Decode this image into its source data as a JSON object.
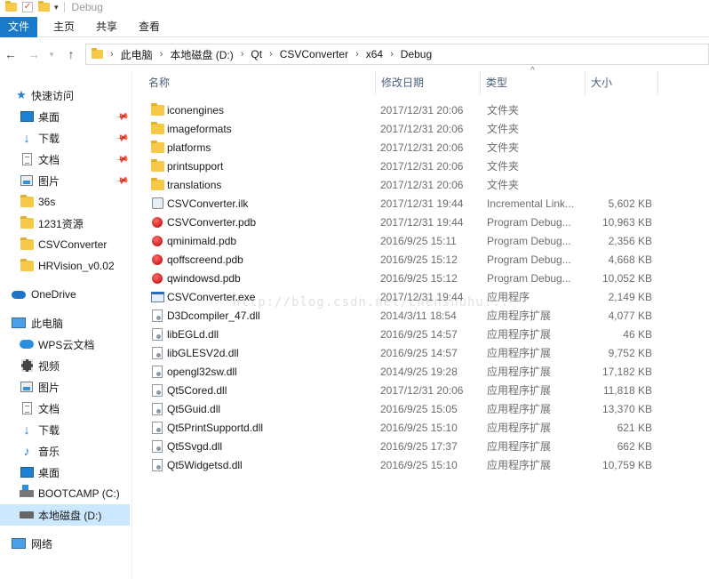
{
  "window": {
    "title": "Debug"
  },
  "ribbon": {
    "tabs": [
      "文件",
      "主页",
      "共享",
      "查看"
    ]
  },
  "address": {
    "crumbs": [
      "此电脑",
      "本地磁盘 (D:)",
      "Qt",
      "CSVConverter",
      "x64",
      "Debug"
    ]
  },
  "sidebar": {
    "quick_access": "快速访问",
    "pinned": [
      {
        "label": "桌面",
        "icon": "desktop-icon"
      },
      {
        "label": "下载",
        "icon": "download-icon"
      },
      {
        "label": "文档",
        "icon": "document-icon"
      },
      {
        "label": "图片",
        "icon": "pictures-icon"
      }
    ],
    "recent": [
      "36s",
      "1231资源",
      "CSVConverter",
      "HRVision_v0.02"
    ],
    "onedrive": "OneDrive",
    "this_pc": "此电脑",
    "pc_items": [
      {
        "label": "WPS云文档",
        "icon": "wps-cloud-icon"
      },
      {
        "label": "视频",
        "icon": "video-icon"
      },
      {
        "label": "图片",
        "icon": "pictures-icon"
      },
      {
        "label": "文档",
        "icon": "document-icon"
      },
      {
        "label": "下载",
        "icon": "download-icon"
      },
      {
        "label": "音乐",
        "icon": "music-icon"
      },
      {
        "label": "桌面",
        "icon": "desktop-icon"
      },
      {
        "label": "BOOTCAMP (C:)",
        "icon": "windows-drive-icon"
      },
      {
        "label": "本地磁盘 (D:)",
        "icon": "drive-icon"
      }
    ],
    "network": "网络"
  },
  "columns": {
    "name": "名称",
    "date": "修改日期",
    "type": "类型",
    "size": "大小"
  },
  "files": [
    {
      "name": "iconengines",
      "date": "2017/12/31 20:06",
      "type": "文件夹",
      "size": "",
      "icon": "folder-icon"
    },
    {
      "name": "imageformats",
      "date": "2017/12/31 20:06",
      "type": "文件夹",
      "size": "",
      "icon": "folder-icon"
    },
    {
      "name": "platforms",
      "date": "2017/12/31 20:06",
      "type": "文件夹",
      "size": "",
      "icon": "folder-icon"
    },
    {
      "name": "printsupport",
      "date": "2017/12/31 20:06",
      "type": "文件夹",
      "size": "",
      "icon": "folder-icon"
    },
    {
      "name": "translations",
      "date": "2017/12/31 20:06",
      "type": "文件夹",
      "size": "",
      "icon": "folder-icon"
    },
    {
      "name": "CSVConverter.ilk",
      "date": "2017/12/31 19:44",
      "type": "Incremental Link...",
      "size": "5,602 KB",
      "icon": "ilk-file-icon"
    },
    {
      "name": "CSVConverter.pdb",
      "date": "2017/12/31 19:44",
      "type": "Program Debug...",
      "size": "10,963 KB",
      "icon": "pdb-file-icon"
    },
    {
      "name": "qminimald.pdb",
      "date": "2016/9/25 15:11",
      "type": "Program Debug...",
      "size": "2,356 KB",
      "icon": "pdb-file-icon"
    },
    {
      "name": "qoffscreend.pdb",
      "date": "2016/9/25 15:12",
      "type": "Program Debug...",
      "size": "4,668 KB",
      "icon": "pdb-file-icon"
    },
    {
      "name": "qwindowsd.pdb",
      "date": "2016/9/25 15:12",
      "type": "Program Debug...",
      "size": "10,052 KB",
      "icon": "pdb-file-icon"
    },
    {
      "name": "CSVConverter.exe",
      "date": "2017/12/31 19:44",
      "type": "应用程序",
      "size": "2,149 KB",
      "icon": "exe-file-icon"
    },
    {
      "name": "D3Dcompiler_47.dll",
      "date": "2014/3/11 18:54",
      "type": "应用程序扩展",
      "size": "4,077 KB",
      "icon": "dll-file-icon"
    },
    {
      "name": "libEGLd.dll",
      "date": "2016/9/25 14:57",
      "type": "应用程序扩展",
      "size": "46 KB",
      "icon": "dll-file-icon"
    },
    {
      "name": "libGLESV2d.dll",
      "date": "2016/9/25 14:57",
      "type": "应用程序扩展",
      "size": "9,752 KB",
      "icon": "dll-file-icon"
    },
    {
      "name": "opengl32sw.dll",
      "date": "2014/9/25 19:28",
      "type": "应用程序扩展",
      "size": "17,182 KB",
      "icon": "dll-file-icon"
    },
    {
      "name": "Qt5Cored.dll",
      "date": "2017/12/31 20:06",
      "type": "应用程序扩展",
      "size": "11,818 KB",
      "icon": "dll-file-icon"
    },
    {
      "name": "Qt5Guid.dll",
      "date": "2016/9/25 15:05",
      "type": "应用程序扩展",
      "size": "13,370 KB",
      "icon": "dll-file-icon"
    },
    {
      "name": "Qt5PrintSupportd.dll",
      "date": "2016/9/25 15:10",
      "type": "应用程序扩展",
      "size": "621 KB",
      "icon": "dll-file-icon"
    },
    {
      "name": "Qt5Svgd.dll",
      "date": "2016/9/25 17:37",
      "type": "应用程序扩展",
      "size": "662 KB",
      "icon": "dll-file-icon"
    },
    {
      "name": "Qt5Widgetsd.dll",
      "date": "2016/9/25 15:10",
      "type": "应用程序扩展",
      "size": "10,759 KB",
      "icon": "dll-file-icon"
    }
  ],
  "watermark": "http://blog.csdn.net/chenshuhu..."
}
